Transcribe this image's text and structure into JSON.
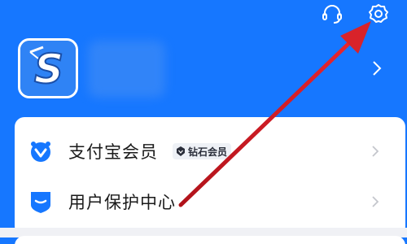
{
  "header": {
    "icons": {
      "support": "headset-icon",
      "settings": "gear-icon"
    }
  },
  "profile": {
    "avatar_letter": "S"
  },
  "menu": {
    "items": [
      {
        "label": "支付宝会员",
        "badge": "钻石会员",
        "icon": "member-crown-icon"
      },
      {
        "label": "用户保护中心",
        "icon": "shield-icon"
      }
    ]
  },
  "colors": {
    "header_blue": "#1677ff",
    "arrow_red": "#d8232a"
  }
}
